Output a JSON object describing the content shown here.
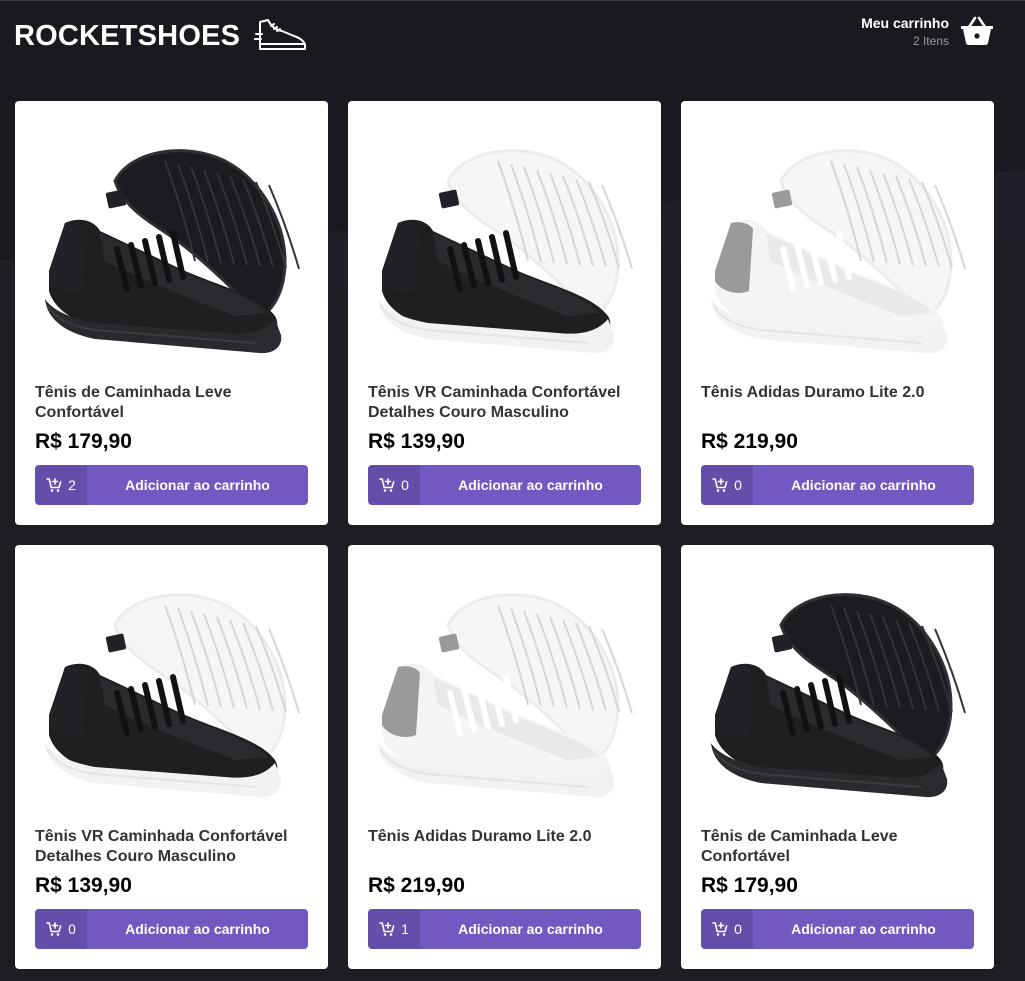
{
  "header": {
    "logo_text": "ROCKETSHOES",
    "logo_icon": "sneaker-icon",
    "cart": {
      "title": "Meu carrinho",
      "count": "2 Itens",
      "icon": "basket-icon"
    }
  },
  "products": [
    {
      "name": "Tênis de Caminhada Leve Confortável",
      "price": "R$ 179,90",
      "qty": "2",
      "button": "Adicionar ao carrinho",
      "variant": "black"
    },
    {
      "name": "Tênis VR Caminhada Confortável Detalhes Couro Masculino",
      "price": "R$ 139,90",
      "qty": "0",
      "button": "Adicionar ao carrinho",
      "variant": "black-white"
    },
    {
      "name": "Tênis Adidas Duramo Lite 2.0",
      "price": "R$ 219,90",
      "qty": "0",
      "button": "Adicionar ao carrinho",
      "variant": "white-grey"
    },
    {
      "name": "Tênis VR Caminhada Confortável Detalhes Couro Masculino",
      "price": "R$ 139,90",
      "qty": "0",
      "button": "Adicionar ao carrinho",
      "variant": "black-white"
    },
    {
      "name": "Tênis Adidas Duramo Lite 2.0",
      "price": "R$ 219,90",
      "qty": "1",
      "button": "Adicionar ao carrinho",
      "variant": "white-grey"
    },
    {
      "name": "Tênis de Caminhada Leve Confortável",
      "price": "R$ 179,90",
      "qty": "0",
      "button": "Adicionar ao carrinho",
      "variant": "black"
    }
  ],
  "colors": {
    "background": "#191920",
    "accent": "#7159c1",
    "card": "#ffffff"
  }
}
